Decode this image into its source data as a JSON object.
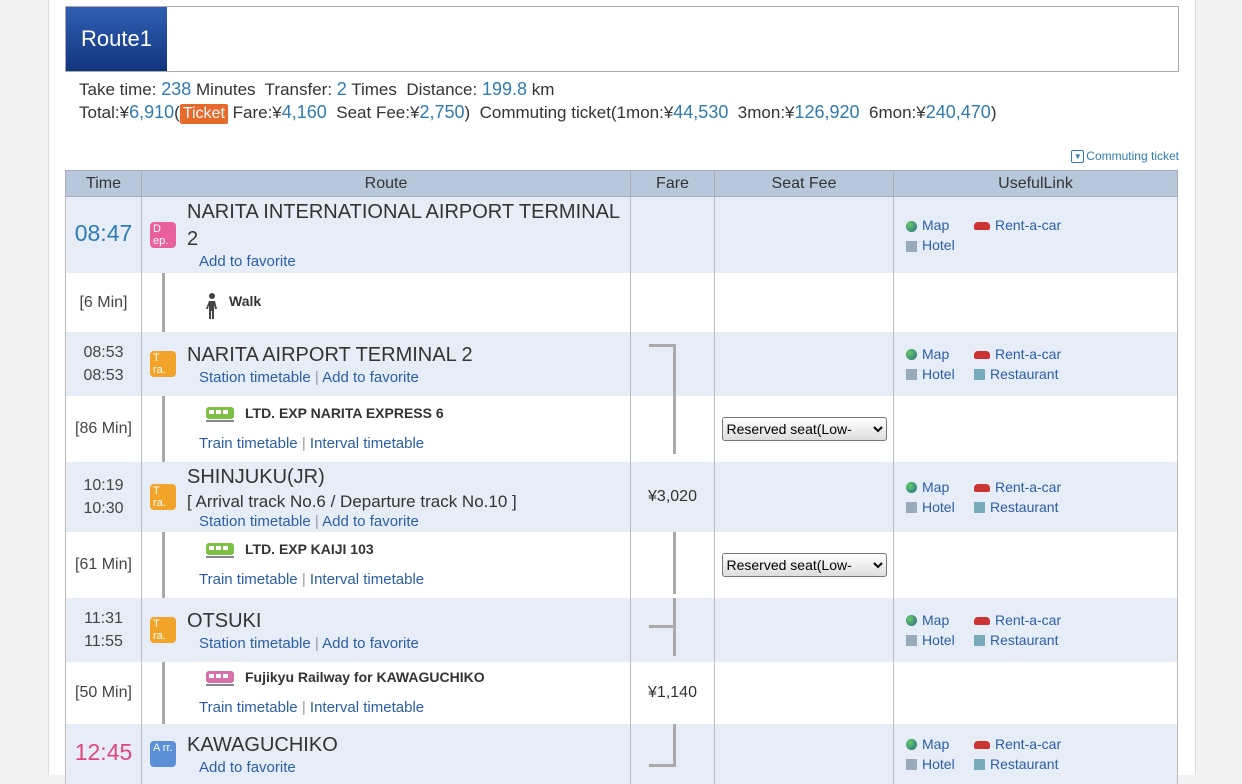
{
  "route": {
    "title": "Route1"
  },
  "summary": {
    "take_time_label": "Take time:",
    "take_time": "238",
    "take_time_unit": "Minutes",
    "transfer_label": "Transfer:",
    "transfer": "2",
    "transfer_unit": "Times",
    "distance_label": "Distance:",
    "distance": "199.8",
    "distance_unit": "km",
    "total_label": "Total:¥",
    "total": "6,910",
    "ticket_label": "Ticket",
    "fare_label": "Fare:¥",
    "fare": "4,160",
    "seat_label": "Seat Fee:¥",
    "seat": "2,750",
    "commute_label": "Commuting ticket(1mon:¥",
    "mon1": "44,530",
    "mon3_label": "3mon:¥",
    "mon3": "126,920",
    "mon6_label": "6mon:¥",
    "mon6": "240,470"
  },
  "commute_link": "Commuting ticket",
  "headers": {
    "time": "Time",
    "route": "Route",
    "fare": "Fare",
    "seat": "Seat Fee",
    "useful": "UsefulLink"
  },
  "links": {
    "map": "Map",
    "car": "Rent-a-car",
    "hotel": "Hotel",
    "restaurant": "Restaurant",
    "station_tt": "Station timetable",
    "favorite": "Add to favorite",
    "train_tt": "Train timetable",
    "interval_tt": "Interval timetable",
    "sep": "|"
  },
  "icons": {
    "dep": "D ep.",
    "tra": "T ra.",
    "arr": "A rr."
  },
  "seat_select": "Reserved seat(Low-",
  "rows": {
    "s1": {
      "time": "08:47",
      "name": "NARITA INTERNATIONAL AIRPORT TERMINAL 2"
    },
    "m1": {
      "time": "[6 Min]",
      "name": "Walk"
    },
    "s2": {
      "time1": "08:53",
      "time2": "08:53",
      "name": "NARITA AIRPORT TERMINAL 2"
    },
    "m2": {
      "time": "[86 Min]",
      "name": "LTD. EXP NARITA EXPRESS 6"
    },
    "s3": {
      "time1": "10:19",
      "time2": "10:30",
      "name": "SHINJUKU(JR)",
      "track": "[ Arrival track No.6 / Departure track No.10 ]",
      "fare": "¥3,020"
    },
    "m3": {
      "time": "[61 Min]",
      "name": "LTD. EXP KAIJI 103"
    },
    "s4": {
      "time1": "11:31",
      "time2": "11:55",
      "name": "OTSUKI"
    },
    "m4": {
      "time": "[50 Min]",
      "name": "Fujikyu Railway  for KAWAGUCHIKO",
      "fare": "¥1,140"
    },
    "s5": {
      "time": "12:45",
      "name": "KAWAGUCHIKO"
    }
  }
}
